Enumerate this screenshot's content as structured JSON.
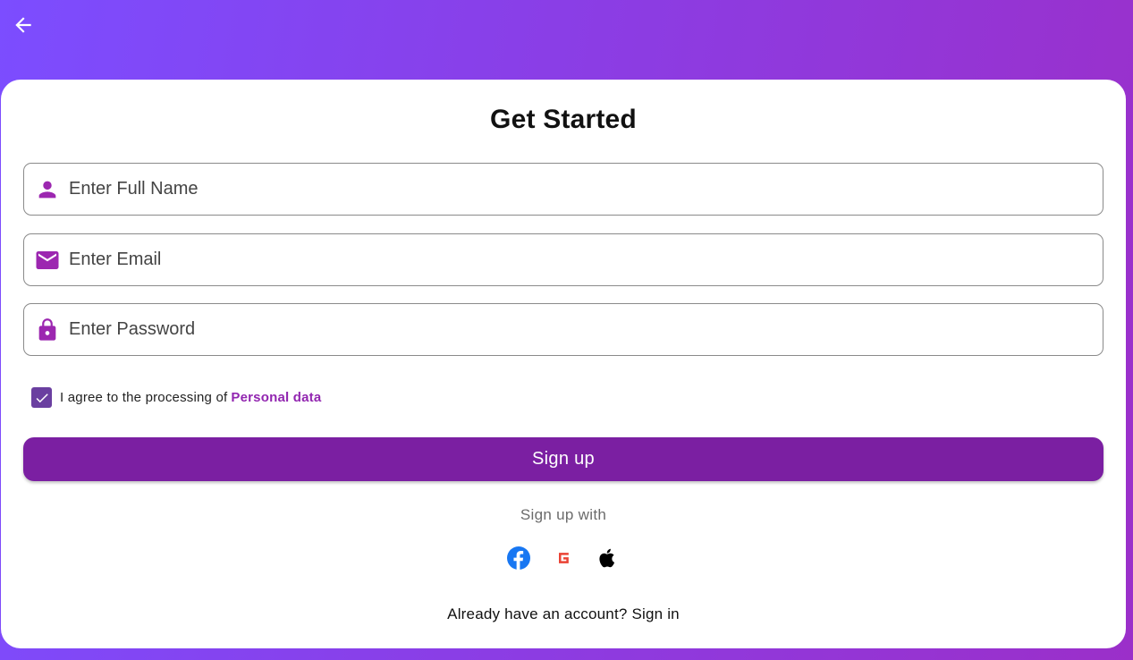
{
  "header": {
    "back_icon": "arrow-left-icon"
  },
  "form": {
    "title": "Get Started",
    "fields": [
      {
        "icon": "person-icon",
        "placeholder": "Enter Full Name",
        "value": ""
      },
      {
        "icon": "mail-icon",
        "placeholder": "Enter Email",
        "value": ""
      },
      {
        "icon": "lock-icon",
        "placeholder": "Enter Password",
        "value": ""
      }
    ],
    "agree": {
      "checked": true,
      "text": "I agree to the processing of",
      "link": "Personal data"
    },
    "signup_label": "Sign up",
    "signup_with": "Sign up with",
    "socials": [
      "facebook-icon",
      "google-icon",
      "apple-icon"
    ],
    "signin_text": "Already have an account? Sign in"
  },
  "colors": {
    "primary": "#7b1fa2",
    "accent": "#9c27b0",
    "checkbox": "#6a3fa0",
    "gradient_start": "#7c4dff",
    "gradient_end": "#9b2fc9",
    "facebook": "#1877f2",
    "google": "#ea4335"
  }
}
